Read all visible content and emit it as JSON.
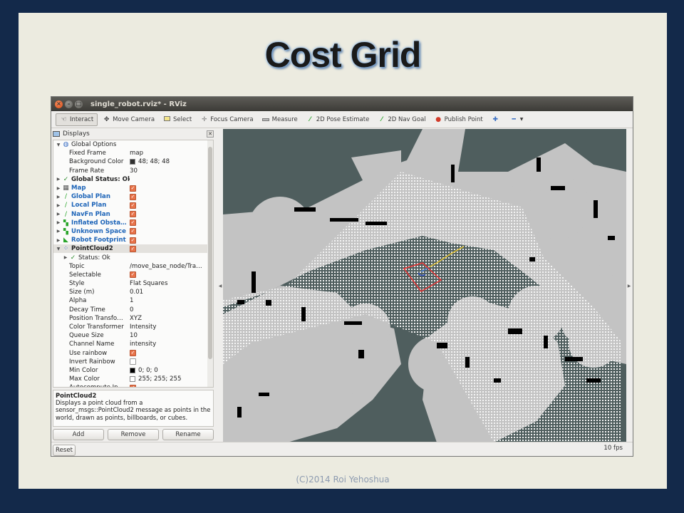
{
  "slide": {
    "title": "Cost Grid",
    "footer": "(C)2014 Roi Yehoshua"
  },
  "window": {
    "title": "single_robot.rviz* - RViz"
  },
  "toolbar": {
    "tools": [
      {
        "label": "Interact",
        "icon": "hand-icon",
        "active": true
      },
      {
        "label": "Move Camera",
        "icon": "move-camera-icon"
      },
      {
        "label": "Select",
        "icon": "select-icon"
      },
      {
        "label": "Focus Camera",
        "icon": "focus-camera-icon"
      },
      {
        "label": "Measure",
        "icon": "ruler-icon"
      },
      {
        "label": "2D Pose Estimate",
        "icon": "pose-arrow-icon"
      },
      {
        "label": "2D Nav Goal",
        "icon": "nav-goal-icon"
      },
      {
        "label": "Publish Point",
        "icon": "pin-icon"
      }
    ]
  },
  "displays_panel": {
    "title": "Displays",
    "rows": [
      {
        "arrow": "▼",
        "icon": "globe-icon",
        "name": "Global Options",
        "value": "",
        "style": "normal",
        "indent": 0
      },
      {
        "name": "Fixed Frame",
        "value": "map",
        "indent": 1
      },
      {
        "name": "Background Color",
        "value": "48; 48; 48",
        "swatch": "#303030",
        "indent": 1
      },
      {
        "name": "Frame Rate",
        "value": "30",
        "indent": 1
      },
      {
        "arrow": "▶",
        "icon": "check-icon",
        "name": "Global Status: Ok",
        "value": "",
        "indent": 0
      },
      {
        "arrow": "▶",
        "icon": "map-icon",
        "name": "Map",
        "style": "blue",
        "checked": true,
        "indent": 0
      },
      {
        "arrow": "▶",
        "icon": "path-icon",
        "name": "Global Plan",
        "style": "blue",
        "checked": true,
        "indent": 0
      },
      {
        "arrow": "▶",
        "icon": "path-icon",
        "name": "Local Plan",
        "style": "blue",
        "checked": true,
        "indent": 0
      },
      {
        "arrow": "▶",
        "icon": "path-icon",
        "name": "NavFn Plan",
        "style": "blue",
        "checked": true,
        "indent": 0
      },
      {
        "arrow": "▶",
        "icon": "grid-cells-icon",
        "name": "Inflated Obsta…",
        "style": "blue",
        "checked": true,
        "indent": 0
      },
      {
        "arrow": "▶",
        "icon": "grid-cells-icon",
        "name": "Unknown Space",
        "style": "blue",
        "checked": true,
        "indent": 0
      },
      {
        "arrow": "▶",
        "icon": "footprint-icon",
        "name": "Robot Footprint",
        "style": "blue",
        "checked": true,
        "indent": 0
      },
      {
        "arrow": "▼",
        "icon": "pointcloud-icon",
        "name": "PointCloud2",
        "style": "bold",
        "checked": true,
        "indent": 0,
        "selected": true
      },
      {
        "arrow": "▶",
        "icon": "check-icon",
        "name": "Status: Ok",
        "indent": 1
      },
      {
        "name": "Topic",
        "value": "/move_base_node/Tra…",
        "indent": 1
      },
      {
        "name": "Selectable",
        "checked": true,
        "indent": 1
      },
      {
        "name": "Style",
        "value": "Flat Squares",
        "indent": 1
      },
      {
        "name": "Size (m)",
        "value": "0.01",
        "indent": 1
      },
      {
        "name": "Alpha",
        "value": "1",
        "indent": 1
      },
      {
        "name": "Decay Time",
        "value": "0",
        "indent": 1
      },
      {
        "name": "Position Transfo…",
        "value": "XYZ",
        "indent": 1
      },
      {
        "name": "Color Transformer",
        "value": "Intensity",
        "indent": 1
      },
      {
        "name": "Queue Size",
        "value": "10",
        "indent": 1
      },
      {
        "name": "Channel Name",
        "value": "intensity",
        "indent": 1
      },
      {
        "name": "Use rainbow",
        "checked": true,
        "indent": 1
      },
      {
        "name": "Invert Rainbow",
        "checked": false,
        "indent": 1
      },
      {
        "name": "Min Color",
        "value": "0; 0; 0",
        "swatch": "#000000",
        "indent": 1
      },
      {
        "name": "Max Color",
        "value": "255; 255; 255",
        "swatch": "#ffffff",
        "indent": 1
      },
      {
        "name": "Autocompute In…",
        "checked": true,
        "indent": 1
      }
    ]
  },
  "description": {
    "title": "PointCloud2",
    "text": "Displays a point cloud from a sensor_msgs::PointCloud2 message as points in the world, drawn as points, billboards, or cubes."
  },
  "buttons": {
    "add": "Add",
    "remove": "Remove",
    "rename": "Rename",
    "reset": "Reset"
  },
  "status": {
    "fps": "10 fps"
  },
  "colors": {
    "viewport_bg": "#4f5e5e",
    "costmap_gray": "#c3c3c3",
    "obstacle": "#000000",
    "footprint": "#e83030"
  }
}
